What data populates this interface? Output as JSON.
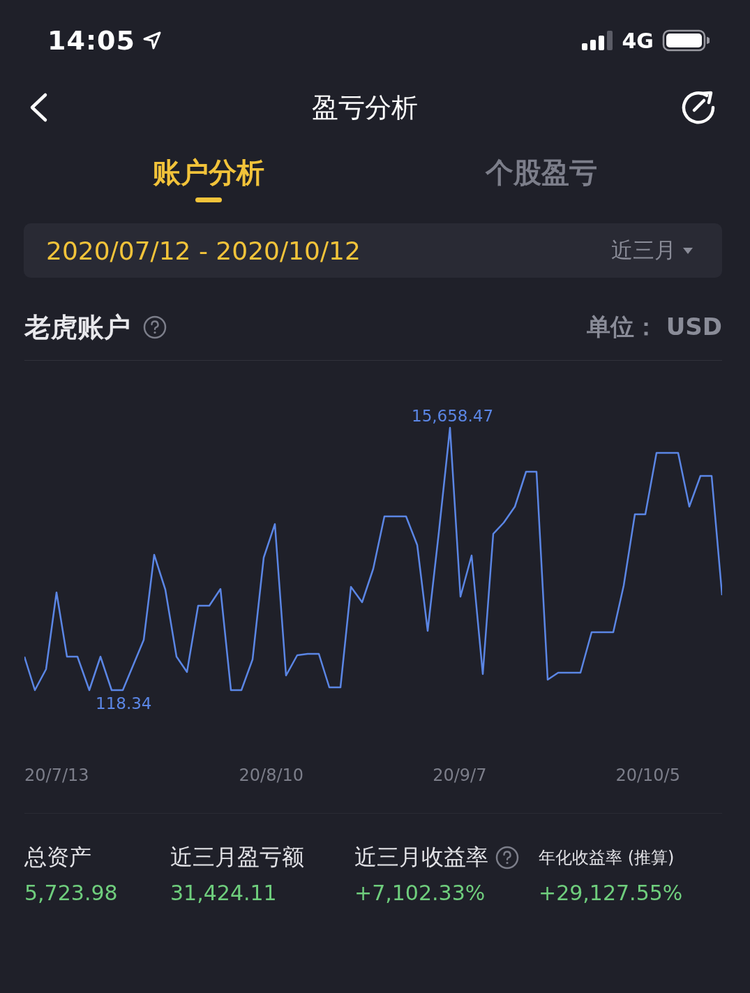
{
  "status_bar": {
    "time": "14:05",
    "network": "4G"
  },
  "nav": {
    "title": "盈亏分析"
  },
  "tabs": [
    {
      "label": "账户分析",
      "selected": true
    },
    {
      "label": "个股盈亏",
      "selected": false
    }
  ],
  "date_range": {
    "value": "2020/07/12 - 2020/10/12",
    "period": "近三月"
  },
  "account": {
    "title": "老虎账户",
    "unit": "单位： USD"
  },
  "chart": {
    "max_label": "15,658.47",
    "min_label": "118.34",
    "x_labels": [
      "20/7/13",
      "20/8/10",
      "20/9/7",
      "20/10/5"
    ]
  },
  "stats": [
    {
      "label": "总资产",
      "value": "5,723.98",
      "help": false,
      "kind": "main"
    },
    {
      "label": "近三月盈亏额",
      "value": "31,424.11",
      "help": false,
      "kind": "main"
    },
    {
      "label": "近三月收益率",
      "value": "+7,102.33%",
      "help": true,
      "kind": "main"
    },
    {
      "label": "年化收益率 (推算)",
      "value": "+29,127.55%",
      "help": false,
      "kind": "estimate"
    }
  ]
}
